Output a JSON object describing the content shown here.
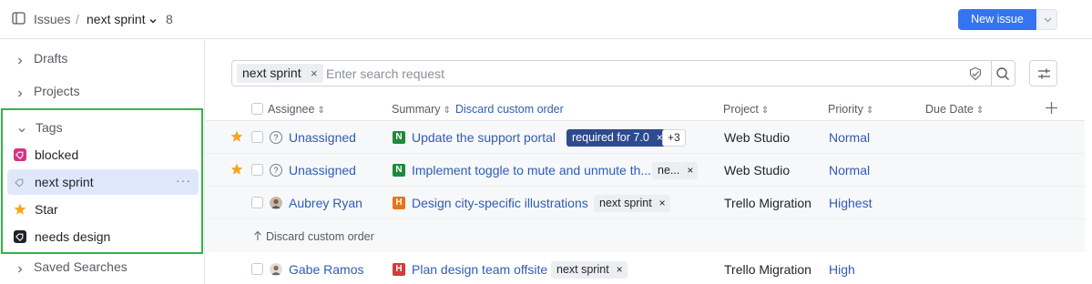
{
  "header": {
    "breadcrumb_root": "Issues",
    "separator": "/",
    "current_view": "next sprint",
    "issue_count": "8",
    "new_issue_label": "New issue"
  },
  "sidebar": {
    "drafts": "Drafts",
    "projects": "Projects",
    "tags_section": "Tags",
    "tags": [
      {
        "label": "blocked",
        "icon": "tag-icon",
        "color": "#d63384"
      },
      {
        "label": "next sprint",
        "icon": "tag-icon",
        "color": "#9aa0a6"
      },
      {
        "label": "Star",
        "icon": "star-icon",
        "color": "#f5a623"
      },
      {
        "label": "needs design",
        "icon": "tag-icon",
        "color": "#1f2328"
      }
    ],
    "more": "···",
    "saved_searches": "Saved Searches"
  },
  "search": {
    "chip": "next sprint",
    "chip_close": "×",
    "placeholder": "Enter search request"
  },
  "table": {
    "columns": {
      "assignee": "Assignee",
      "summary": "Summary",
      "discard": "Discard custom order",
      "project": "Project",
      "priority": "Priority",
      "due_date": "Due Date"
    },
    "rows": [
      {
        "starred": true,
        "avatar": "?",
        "assignee": "Unassigned",
        "type": "N",
        "type_color": "#1f8a3b",
        "summary": "Update the support portal",
        "tags": [
          "required for 7.0"
        ],
        "more_tags": "+3",
        "project": "Web Studio",
        "priority": "Normal"
      },
      {
        "starred": true,
        "avatar": "?",
        "assignee": "Unassigned",
        "type": "N",
        "type_color": "#1f8a3b",
        "summary": "Implement toggle to mute and unmute th...",
        "tags": [
          "ne..."
        ],
        "project": "Web Studio",
        "priority": "Normal"
      },
      {
        "starred": false,
        "avatar": "photo",
        "assignee": "Aubrey Ryan",
        "type": "H",
        "type_color": "#e8741c",
        "summary": "Design city-specific illustrations",
        "tags": [
          "next sprint"
        ],
        "project": "Trello Migration",
        "priority": "Highest"
      },
      {
        "starred": false,
        "avatar": "photo",
        "assignee": "Gabe Ramos",
        "type": "H",
        "type_color": "#d23b3b",
        "summary": "Plan design team offsite",
        "tags": [
          "next sprint"
        ],
        "project": "Trello Migration",
        "priority": "High"
      }
    ],
    "discard_row": "Discard custom order"
  },
  "colors": {
    "accent": "#3574f0",
    "link": "#2f5bb7",
    "highlight_border": "#34b34a"
  }
}
